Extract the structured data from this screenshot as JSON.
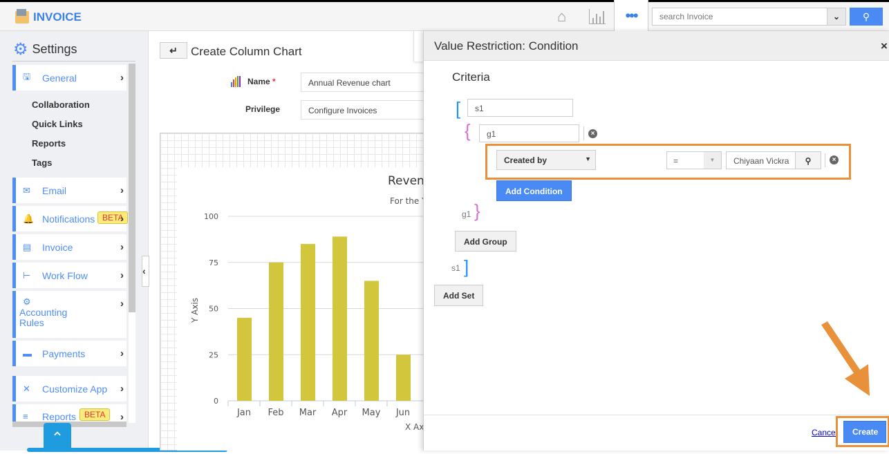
{
  "app": {
    "title": "INVOICE",
    "search_placeholder": "search Invoice"
  },
  "sidebar": {
    "title": "Settings",
    "items": [
      {
        "label": "General",
        "icon": "monitor-icon"
      },
      {
        "label": "Email",
        "icon": "envelope-icon"
      },
      {
        "label": "Notifications",
        "icon": "bell-icon",
        "badge": "BETA"
      },
      {
        "label": "Invoice",
        "icon": "invoice-icon"
      },
      {
        "label": "Work Flow",
        "icon": "workflow-icon"
      },
      {
        "label": "Accounting Rules",
        "icon": "gear-list-icon"
      },
      {
        "label": "Payments",
        "icon": "card-icon"
      },
      {
        "label": "Customize App",
        "icon": "tools-icon"
      },
      {
        "label": "Reports",
        "icon": "reports-icon",
        "badge": "BETA"
      }
    ],
    "subitems": [
      "Collaboration",
      "Quick Links",
      "Reports",
      "Tags"
    ]
  },
  "main": {
    "title": "Create Column Chart",
    "name_label": "Name",
    "required": "*",
    "name_value": "Annual Revenue chart",
    "privilege_label": "Privilege",
    "privilege_value": "Configure Invoices"
  },
  "chart_data": {
    "type": "bar",
    "title": "Reven",
    "subtitle": "For the Y",
    "xlabel": "X Axis",
    "ylabel": "Y Axis",
    "categories": [
      "Jan",
      "Feb",
      "Mar",
      "Apr",
      "May",
      "Jun"
    ],
    "values": [
      45,
      75,
      85,
      89,
      65,
      25
    ],
    "ylim": [
      0,
      100
    ],
    "yticks": [
      0,
      25,
      50,
      75,
      100
    ],
    "grid": true,
    "color": "#d2c63c"
  },
  "panel": {
    "title": "Value Restriction: Condition",
    "criteria": "Criteria",
    "set_name": "s1",
    "group_name": "g1",
    "field": "Created by",
    "operator": "=",
    "value": "Chiyaan Vickra",
    "add_condition": "Add Condition",
    "group_end": "g1",
    "add_group": "Add Group",
    "set_end": "s1",
    "add_set": "Add Set",
    "cancel": "Cancel",
    "create": "Create"
  },
  "colors": {
    "accent": "#4a8af4",
    "highlight": "#e8913a"
  }
}
